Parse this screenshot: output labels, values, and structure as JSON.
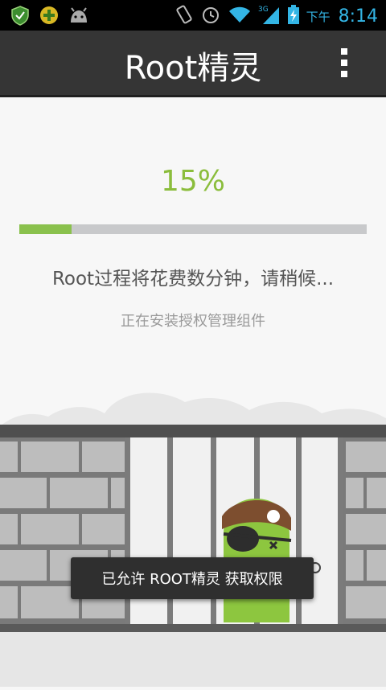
{
  "status_bar": {
    "time": "8:14",
    "ampm": "下午",
    "icons": [
      "shield-icon",
      "plus-badge-icon",
      "android-icon",
      "vibrate-icon",
      "alarm-icon",
      "wifi-icon",
      "signal-3g-icon",
      "battery-charging-icon"
    ]
  },
  "app_bar": {
    "title": "Root精灵",
    "menu_icon": "overflow-menu-icon"
  },
  "progress": {
    "percent_text": "15%",
    "value": 0.15,
    "fill_color": "#8ac14d",
    "track_color": "#c8c9cb"
  },
  "messages": {
    "main": "Root过程将花费数分钟，请稍候...",
    "sub": "正在安装授权管理组件"
  },
  "toast": {
    "text": "已允许 ROOT精灵 获取权限"
  },
  "colors": {
    "accent": "#8bbd3c",
    "app_bar": "#353535",
    "status_accent": "#33b5e5"
  }
}
